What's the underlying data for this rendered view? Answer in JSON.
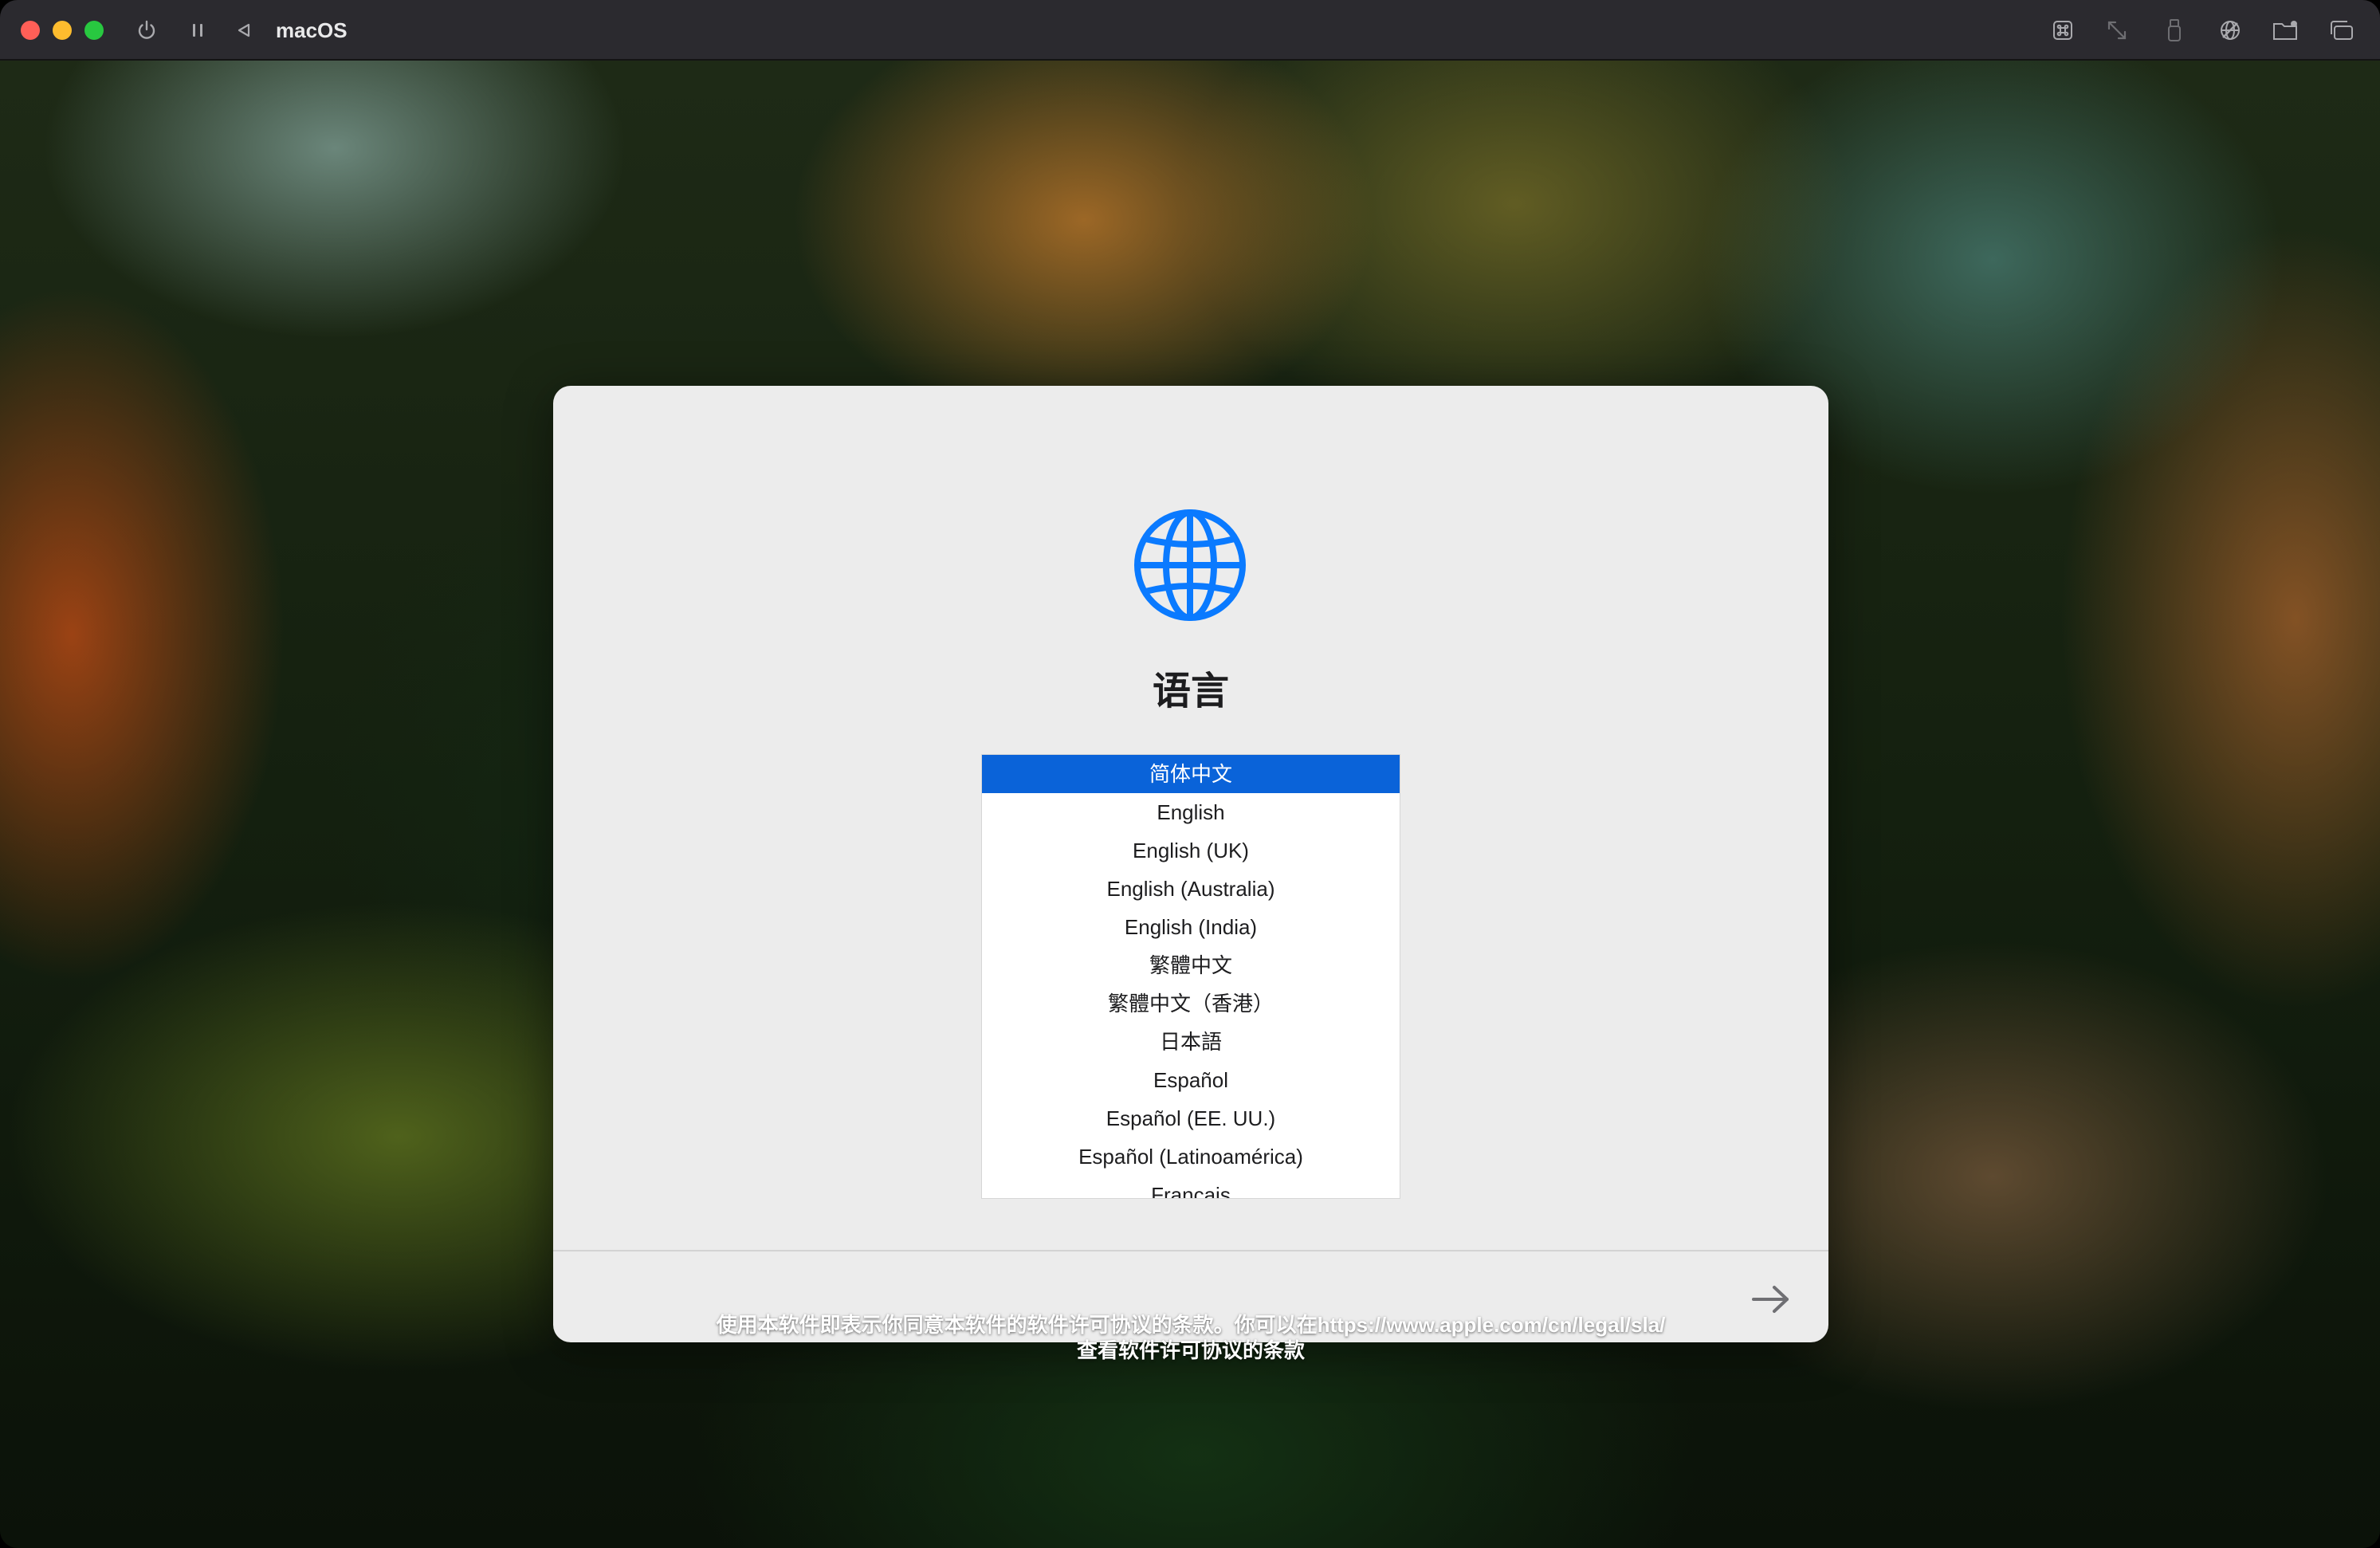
{
  "window": {
    "title": "macOS",
    "controls": {
      "close": "close",
      "minimize": "minimize",
      "zoom": "zoom"
    },
    "toolbar_left_icons": [
      "power-icon",
      "pause-icon",
      "back-triangle-icon"
    ],
    "toolbar_right_icons": [
      "command-key-icon",
      "resize-arrows-icon",
      "usb-icon",
      "network-off-icon",
      "shared-folder-icon",
      "window-stack-icon"
    ]
  },
  "dialog": {
    "icon": "globe-icon",
    "title": "语言",
    "languages": [
      {
        "label": "简体中文",
        "selected": true
      },
      {
        "label": "English",
        "selected": false
      },
      {
        "label": "English (UK)",
        "selected": false
      },
      {
        "label": "English (Australia)",
        "selected": false
      },
      {
        "label": "English (India)",
        "selected": false
      },
      {
        "label": "繁體中文",
        "selected": false
      },
      {
        "label": "繁體中文（香港）",
        "selected": false
      },
      {
        "label": "日本語",
        "selected": false
      },
      {
        "label": "Español",
        "selected": false
      },
      {
        "label": "Español (EE. UU.)",
        "selected": false
      },
      {
        "label": "Español (Latinoamérica)",
        "selected": false
      },
      {
        "label": "Français",
        "selected": false
      }
    ],
    "next_button_icon": "right-arrow-icon"
  },
  "license": {
    "line1": "使用本软件即表示你同意本软件的软件许可协议的条款。你可以在https://www.apple.com/cn/legal/sla/",
    "line2": "查看软件许可协议的条款"
  },
  "colors": {
    "accent": "#0a63d9",
    "globe": "#0a7aff",
    "dialog_bg": "#ececec",
    "titlebar_bg": "#2b2a2f"
  }
}
